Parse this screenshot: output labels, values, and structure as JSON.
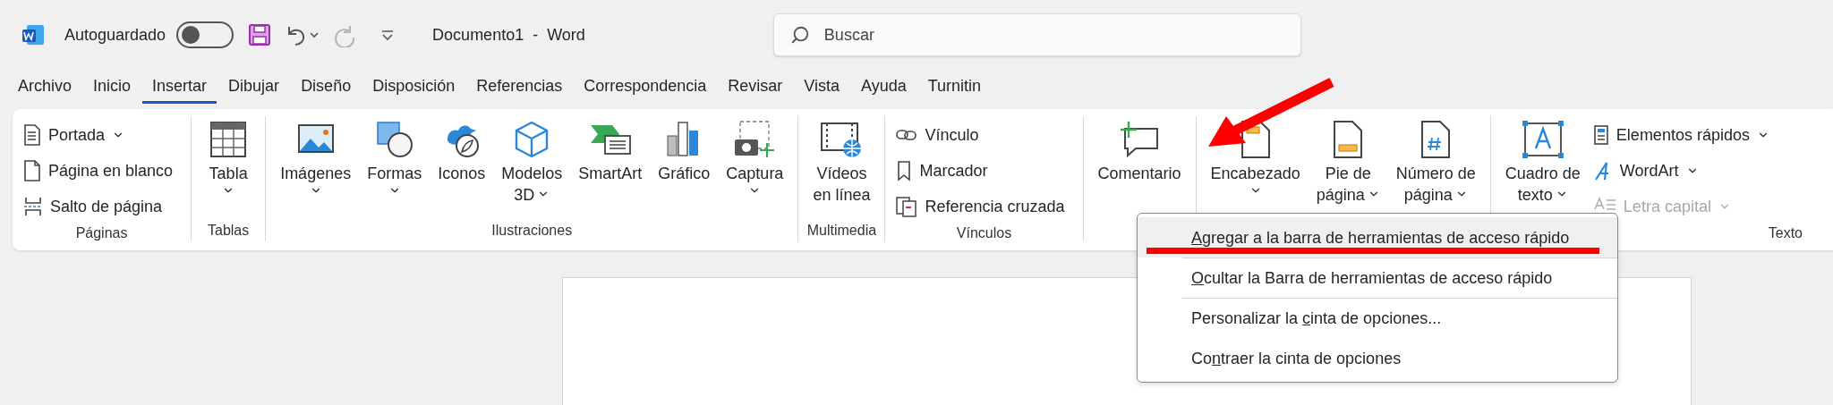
{
  "title_bar": {
    "autosave": {
      "label": "Autoguardado",
      "on": false
    },
    "redo": {
      "disabled": true
    },
    "document_title": "Documento1  -  Word",
    "search": {
      "placeholder": "Buscar"
    }
  },
  "tabs": [
    {
      "label": "Archivo",
      "selected": false
    },
    {
      "label": "Inicio",
      "selected": false
    },
    {
      "label": "Insertar",
      "selected": true
    },
    {
      "label": "Dibujar",
      "selected": false
    },
    {
      "label": "Diseño",
      "selected": false
    },
    {
      "label": "Disposición",
      "selected": false
    },
    {
      "label": "Referencias",
      "selected": false
    },
    {
      "label": "Correspondencia",
      "selected": false
    },
    {
      "label": "Revisar",
      "selected": false
    },
    {
      "label": "Vista",
      "selected": false
    },
    {
      "label": "Ayuda",
      "selected": false
    },
    {
      "label": "Turnitin",
      "selected": false
    }
  ],
  "ribbon": {
    "groups": [
      {
        "label": "Páginas",
        "items": [
          {
            "kind": "small",
            "label": "Portada",
            "dropdown": true,
            "disabled": false
          },
          {
            "kind": "small",
            "label": "Página en blanco",
            "dropdown": false,
            "disabled": false
          },
          {
            "kind": "small",
            "label": "Salto de página",
            "dropdown": false,
            "disabled": false
          }
        ]
      },
      {
        "label": "Tablas",
        "items": [
          {
            "kind": "large",
            "label": "Tabla",
            "dropdown": true
          }
        ]
      },
      {
        "label": "Ilustraciones",
        "items": [
          {
            "kind": "large",
            "label": "Imágenes",
            "dropdown": true
          },
          {
            "kind": "large",
            "label": "Formas",
            "dropdown": true
          },
          {
            "kind": "large",
            "label": "Iconos",
            "dropdown": false
          },
          {
            "kind": "tall",
            "label": "Modelos\n3D",
            "dropdown": true
          },
          {
            "kind": "large",
            "label": "SmartArt",
            "dropdown": false
          },
          {
            "kind": "large",
            "label": "Gráfico",
            "dropdown": false
          },
          {
            "kind": "large",
            "label": "Captura",
            "dropdown": true
          }
        ]
      },
      {
        "label": "Multimedia",
        "items": [
          {
            "kind": "tall",
            "label": "Vídeos\nen línea",
            "dropdown": false
          }
        ]
      },
      {
        "label": "Vínculos",
        "items": [
          {
            "kind": "small",
            "label": "Vínculo",
            "dropdown": false,
            "disabled": false
          },
          {
            "kind": "small",
            "label": "Marcador",
            "dropdown": false,
            "disabled": false
          },
          {
            "kind": "small",
            "label": "Referencia cruzada",
            "dropdown": false,
            "disabled": false
          }
        ]
      },
      {
        "items": [
          {
            "kind": "large",
            "label": "Comentario",
            "dropdown": false
          }
        ]
      },
      {
        "items": [
          {
            "kind": "large",
            "label": "Encabezado",
            "dropdown": true
          },
          {
            "kind": "tall",
            "label": "Pie de\npágina",
            "dropdown": true
          },
          {
            "kind": "tall",
            "label": "Número de\npágina",
            "dropdown": true
          }
        ]
      },
      {
        "label": "Texto",
        "items": [
          {
            "kind": "tall",
            "label": "Cuadro de\ntexto",
            "dropdown": true
          },
          {
            "kind": "small",
            "label": "Elementos rápidos",
            "dropdown": true,
            "disabled": false
          },
          {
            "kind": "small",
            "label": "WordArt",
            "dropdown": true,
            "disabled": false
          },
          {
            "kind": "small",
            "label": "Letra capital",
            "dropdown": true,
            "disabled": true
          }
        ]
      }
    ]
  },
  "context_menu": {
    "items": [
      {
        "key": "A",
        "after": "gregar a la barra de herramientas de acceso rápido",
        "selected": true,
        "separator_before": false
      },
      {
        "key": "O",
        "after": "cultar la Barra de herramientas de acceso rápido",
        "selected": false,
        "separator_before": true
      },
      {
        "before": "Personalizar la ",
        "key": "c",
        "after": "inta de opciones...",
        "selected": false,
        "separator_before": true
      },
      {
        "before": "Co",
        "key": "n",
        "after": "traer la cinta de opciones",
        "selected": false,
        "separator_before": false
      }
    ]
  }
}
